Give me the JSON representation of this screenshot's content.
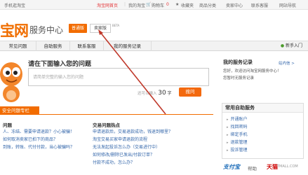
{
  "topbar": {
    "site_name": "手机逛淘宝",
    "home": "淘宝网首页",
    "my_taobao": "我的淘宝",
    "cart": "购物车",
    "cart_count": "0",
    "favorites": "收藏夹",
    "categories": "商品分类",
    "seller_center": "卖家中心",
    "customer_service": "联系客服",
    "site_nav": "网站导航"
  },
  "header": {
    "logo": "宝网",
    "title": "服务中心",
    "normal_button": "普通版",
    "seller_button": "卖家版",
    "beta": "BETA"
  },
  "nav": {
    "items": [
      "常见问题",
      "自助服务",
      "联系客服",
      "我的服务记录"
    ],
    "new_guide": "新手入门"
  },
  "search": {
    "title": "请在下面输入您的问题",
    "placeholder": "请简单完整的输入您的问题",
    "count_prefix": "还可以输入",
    "count_value": "30",
    "count_unit": "字",
    "submit": "搜问"
  },
  "service_records": {
    "title": "我的服务记录",
    "more": "站内信 >",
    "welcome": "您好，欢迎访问淘宝网服务中心！",
    "none": "您暂时无服务记录"
  },
  "self_service": {
    "title": "常用自助服务",
    "items": [
      "开通账户",
      "找回密码",
      "绑定手机",
      "退款管理",
      "投诉管理"
    ]
  },
  "help": {
    "header": "安全问题专栏",
    "col1_title": "问题",
    "col1_items": [
      "人、冻结、需要申请退款？小心被骗！",
      "如何取消卖家已拍下的商品？",
      "到账，转账、代付付款，当心被骗吗？"
    ],
    "col2_title": "交易问题热点",
    "col2_items": [
      "申请退款后，交易退款成功，钱退到哪里？",
      "淘宝交易买家申请退款的流程",
      "无法发起投诉怎么办（交易进行中）",
      "如何修改/删除已发出/付款订单？",
      "付款不成功，怎么办？"
    ]
  },
  "brands": {
    "alipay": "支付宝",
    "help": "帮助",
    "tmall": "天猫",
    "tmall_sub": "TMALL.COM"
  },
  "colors": {
    "accent": "#f26c00",
    "link": "#3366aa",
    "arrow": "#c0392b"
  }
}
